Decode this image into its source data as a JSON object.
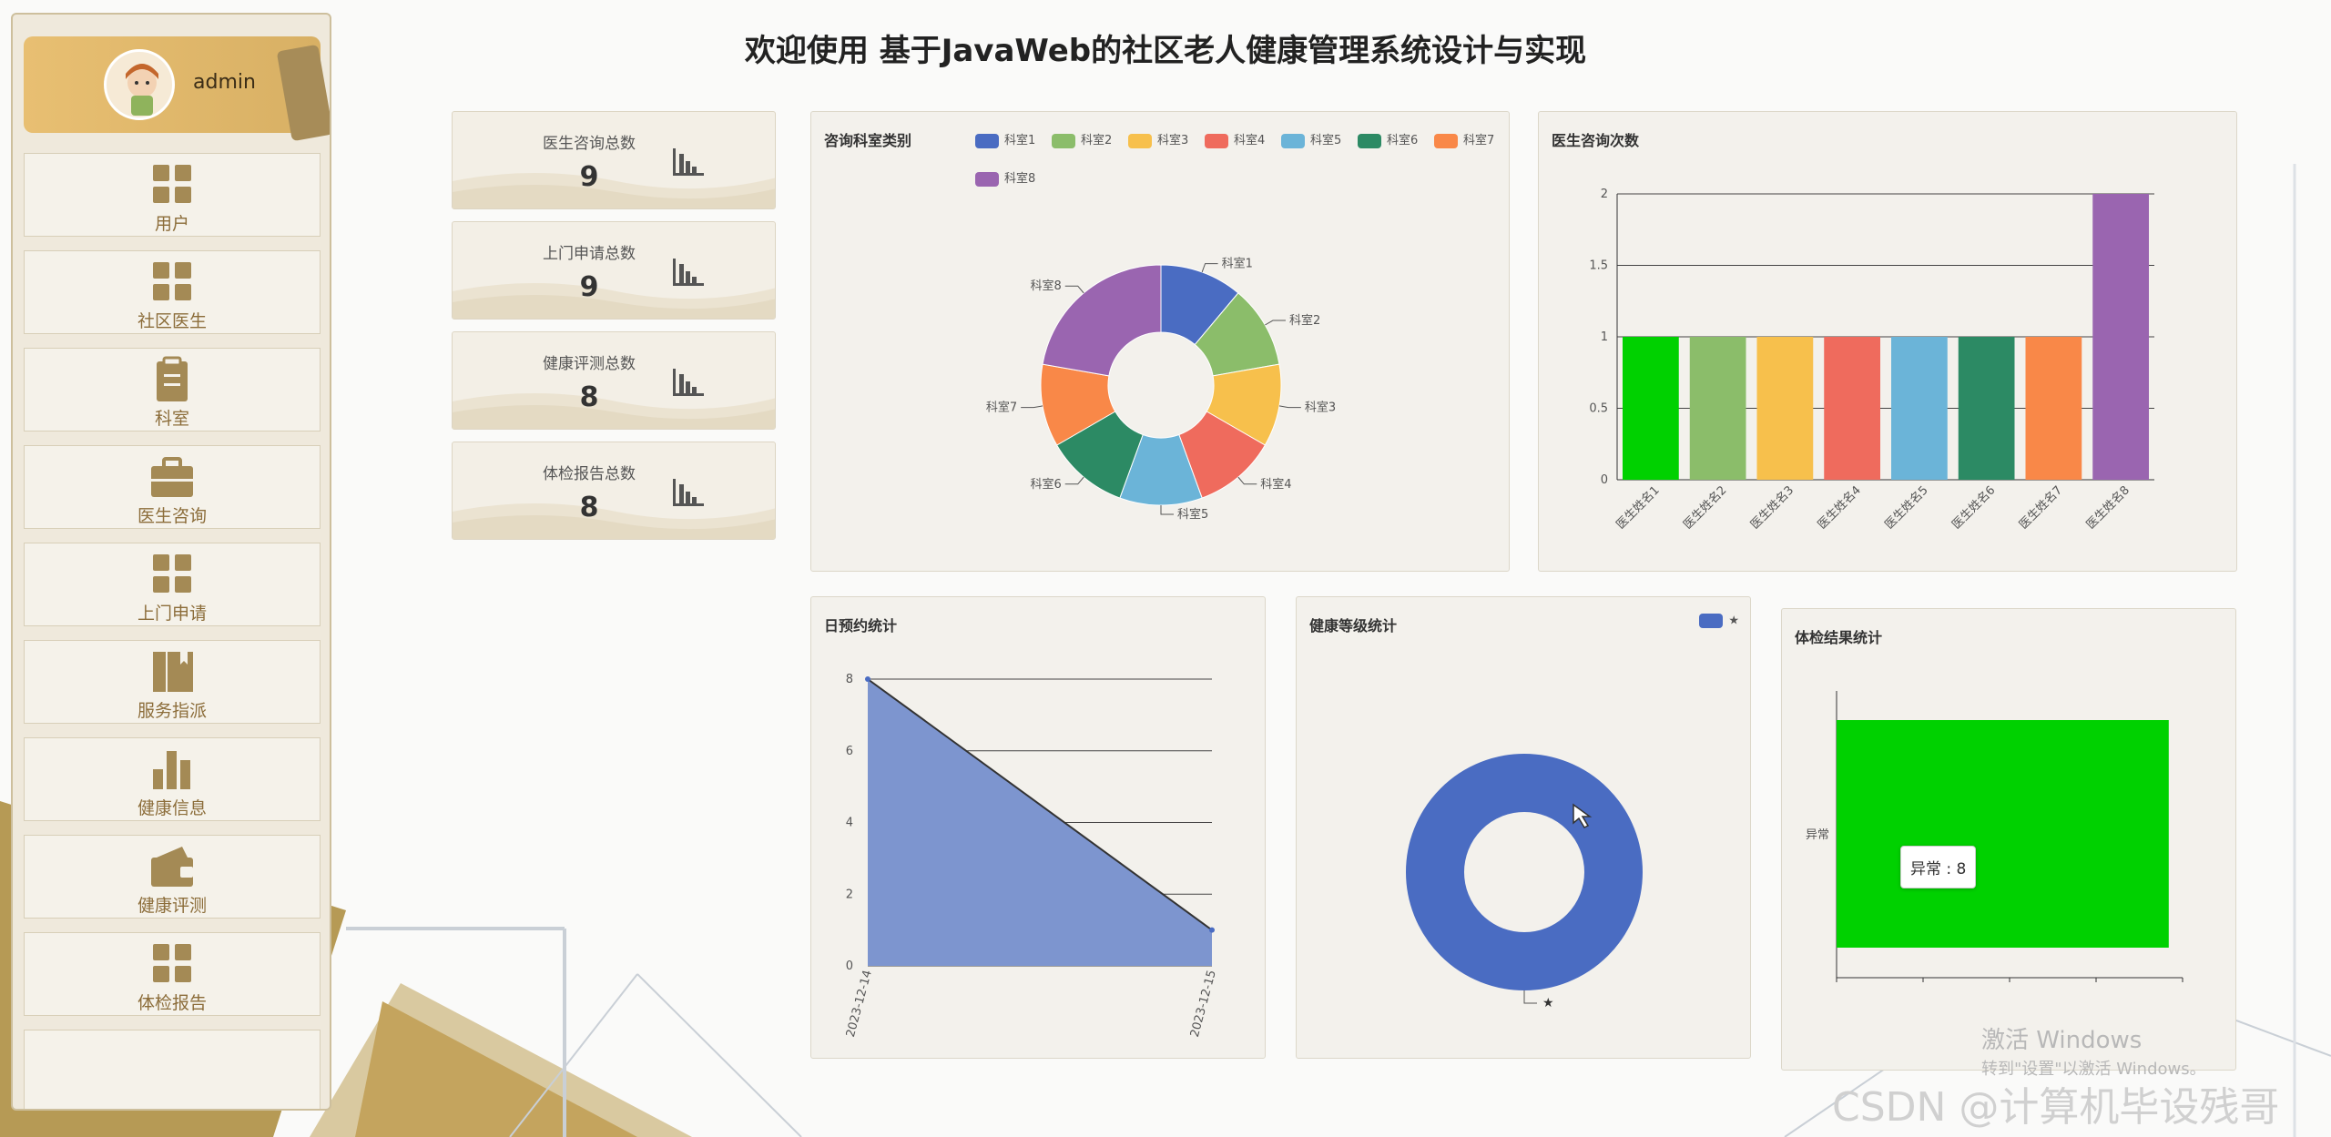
{
  "header": {
    "title": "欢迎使用 基于JavaWeb的社区老人健康管理系统设计与实现"
  },
  "user": {
    "name": "admin"
  },
  "sidebar": {
    "items": [
      {
        "label": "用户",
        "icon": "grid-icon"
      },
      {
        "label": "社区医生",
        "icon": "grid-icon"
      },
      {
        "label": "科室",
        "icon": "clipboard-icon"
      },
      {
        "label": "医生咨询",
        "icon": "briefcase-icon"
      },
      {
        "label": "上门申请",
        "icon": "grid-icon"
      },
      {
        "label": "服务指派",
        "icon": "book-icon"
      },
      {
        "label": "健康信息",
        "icon": "bar-chart-icon"
      },
      {
        "label": "健康评测",
        "icon": "wallet-icon"
      },
      {
        "label": "体检报告",
        "icon": "grid-icon"
      }
    ]
  },
  "stats": [
    {
      "label": "医生咨询总数",
      "value": "9"
    },
    {
      "label": "上门申请总数",
      "value": "9"
    },
    {
      "label": "健康评测总数",
      "value": "8"
    },
    {
      "label": "体检报告总数",
      "value": "8"
    }
  ],
  "colors": {
    "palette": [
      "#4a6cc2",
      "#8bbd6a",
      "#f7c04c",
      "#ef6b5d",
      "#6bb4d8",
      "#2c8a64",
      "#f98848",
      "#9a65b0"
    ],
    "green": "#00d100",
    "area": "#7d95cf"
  },
  "chart_data": [
    {
      "type": "pie",
      "title": "咨询科室类别",
      "categories": [
        "科室1",
        "科室2",
        "科室3",
        "科室4",
        "科室5",
        "科室6",
        "科室7",
        "科室8"
      ],
      "values": [
        1,
        1,
        1,
        1,
        1,
        1,
        1,
        2
      ],
      "legend": "top"
    },
    {
      "type": "bar",
      "title": "医生咨询次数",
      "categories": [
        "医生姓名1",
        "医生姓名2",
        "医生姓名3",
        "医生姓名4",
        "医生姓名5",
        "医生姓名6",
        "医生姓名7",
        "医生姓名8"
      ],
      "values": [
        1,
        1,
        1,
        1,
        1,
        1,
        1,
        2
      ],
      "ylim": [
        0,
        2
      ],
      "yticks": [
        "0",
        "0.5",
        "1",
        "1.5",
        "2"
      ],
      "grid": true
    },
    {
      "type": "area",
      "title": "日预约统计",
      "categories": [
        "2023-12-14",
        "2023-12-15"
      ],
      "values": [
        8,
        1
      ],
      "ylim": [
        0,
        8
      ],
      "yticks": [
        "0",
        "2",
        "4",
        "6",
        "8"
      ],
      "grid": true
    },
    {
      "type": "pie",
      "title": "健康等级统计",
      "categories": [
        "★"
      ],
      "values": [
        1
      ],
      "legend": "top-right"
    },
    {
      "type": "bar",
      "title": "体检结果统计",
      "categories": [
        "异常"
      ],
      "values": [
        8
      ],
      "orientation": "horizontal",
      "tooltip": "异常 : 8"
    }
  ],
  "watermark": {
    "line1": "激活 Windows",
    "line2": "转到\"设置\"以激活 Windows。",
    "csdn": "CSDN @计算机毕设残哥"
  }
}
